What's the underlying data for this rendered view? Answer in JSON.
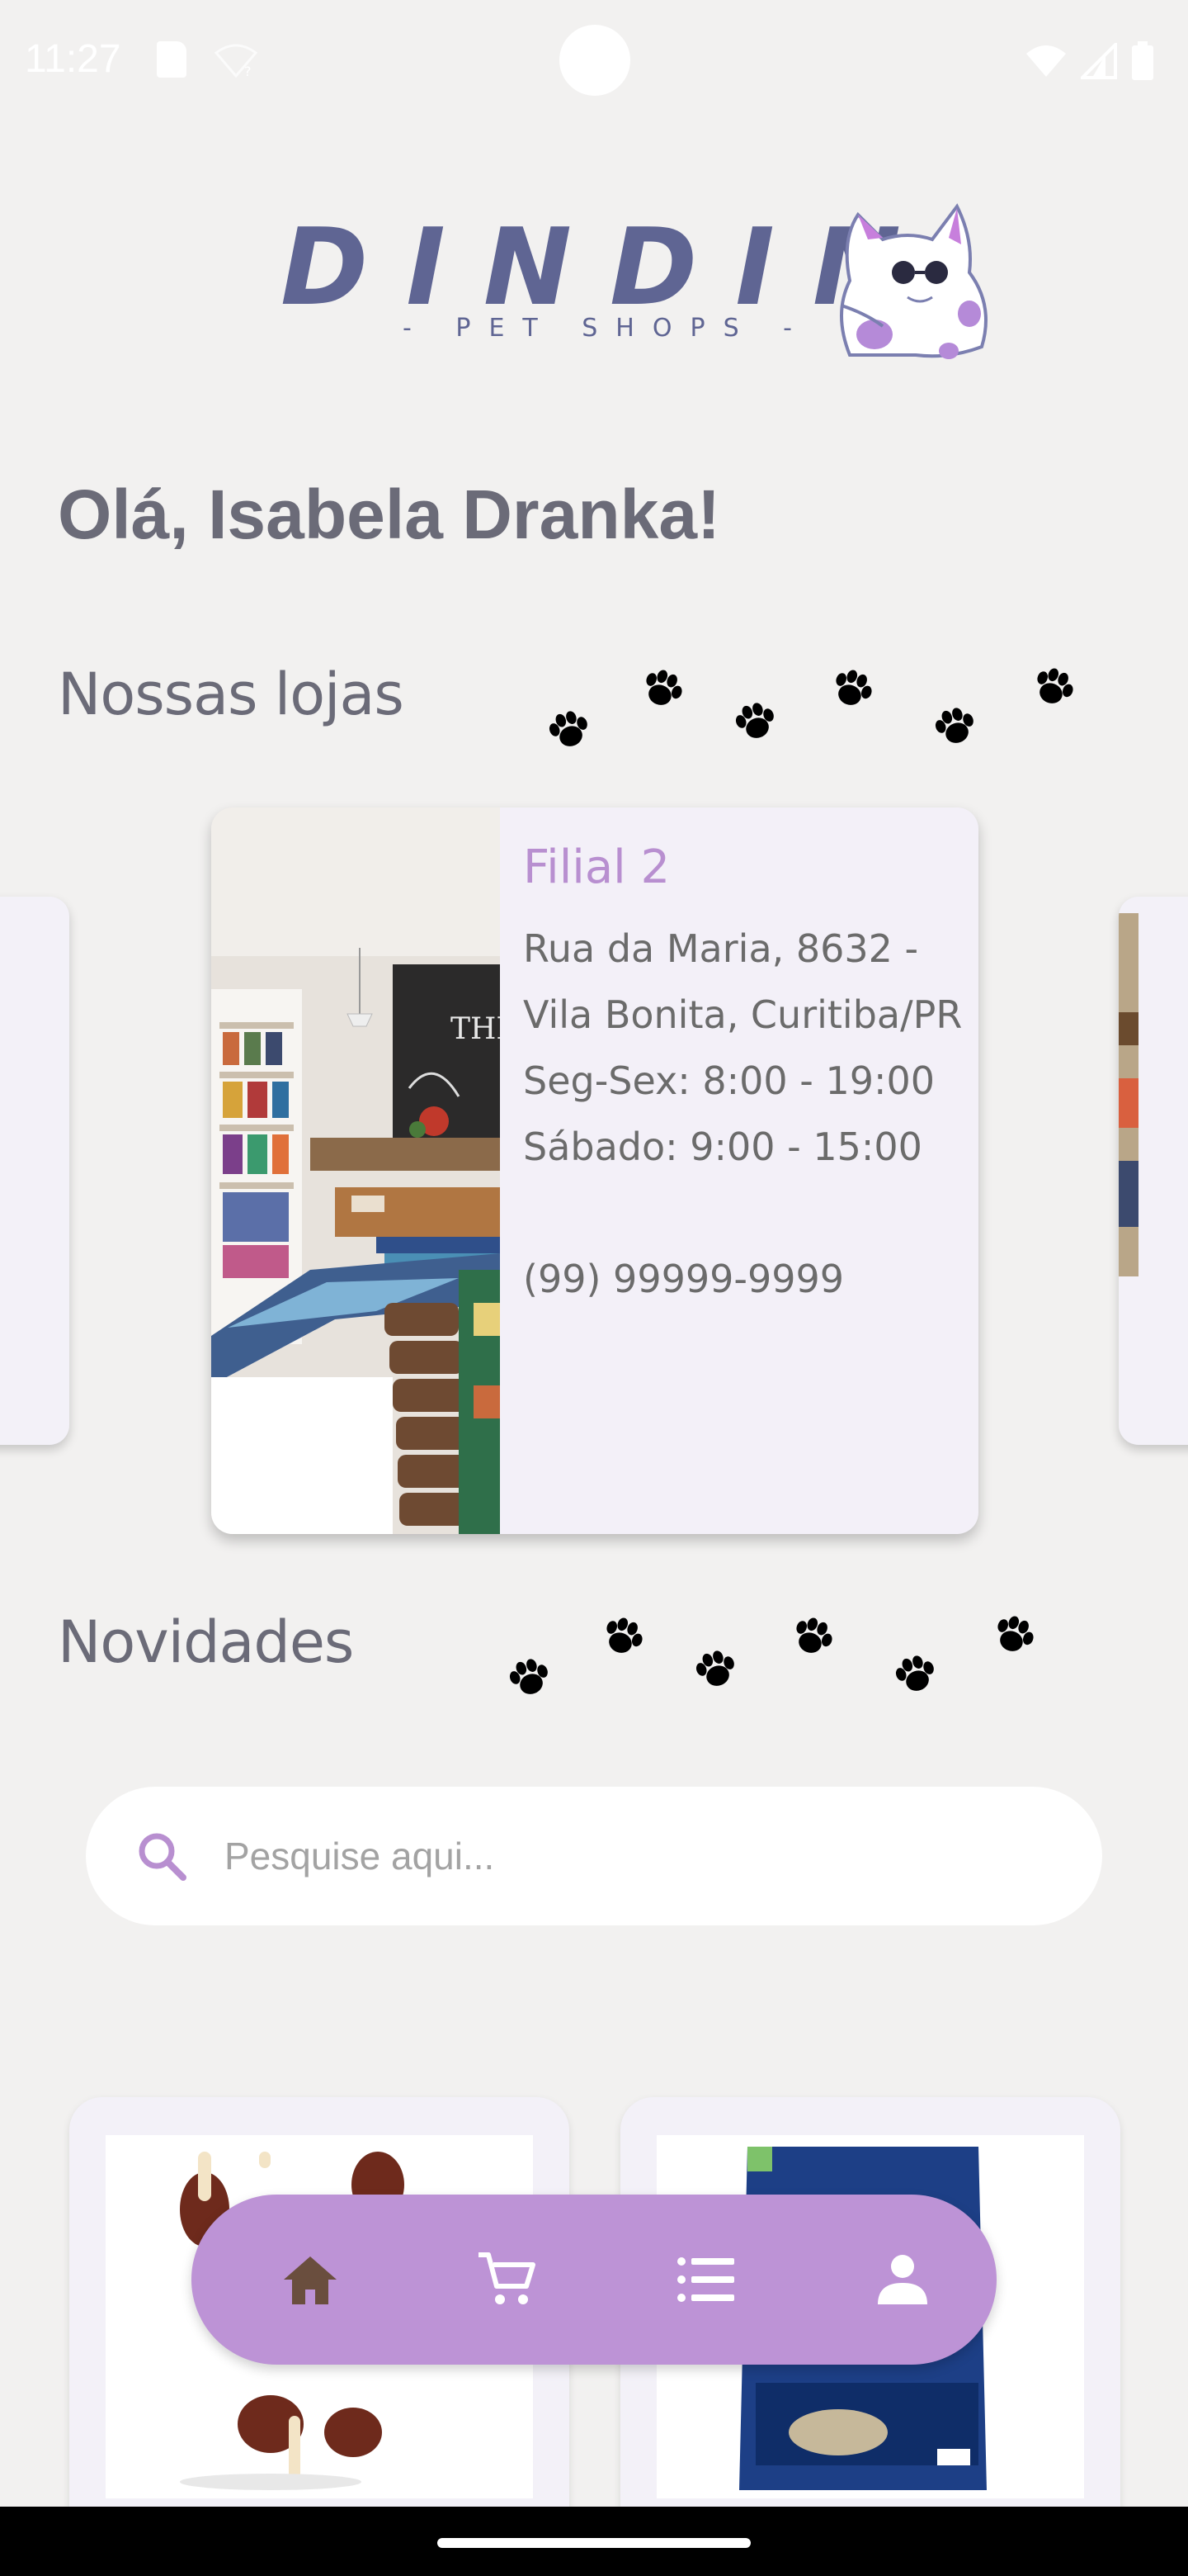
{
  "status_bar": {
    "time": "11:27",
    "icons": [
      "sim-card-icon",
      "wifi-off-icon",
      "wifi-icon",
      "signal-icon",
      "battery-icon"
    ]
  },
  "brand": {
    "name": "DINDIN",
    "tagline": "- PET SHOPS -"
  },
  "greeting": "Olá, Isabela Dranka!",
  "stores": {
    "title": "Nossas lojas",
    "current": {
      "name": "Filial 2",
      "address_line1": "Rua da Maria, 8632 -",
      "address_line2": "Vila Bonita, Curitiba/PR",
      "hours_weekday": "Seg-Sex: 8:00 - 19:00",
      "hours_saturday": "Sábado: 9:00 - 15:00",
      "phone": "(99) 99999-9999"
    }
  },
  "news": {
    "title": "Novidades"
  },
  "search": {
    "placeholder": "Pesquise aqui..."
  },
  "bottom_nav": {
    "items": [
      "home-icon",
      "cart-icon",
      "list-icon",
      "person-icon"
    ],
    "active": "home-icon"
  },
  "colors": {
    "background": "#f2f1f0",
    "accent": "#bd93d6",
    "store_name": "#b88fd0",
    "brand": "#5f6593",
    "text": "#6b6b78"
  }
}
